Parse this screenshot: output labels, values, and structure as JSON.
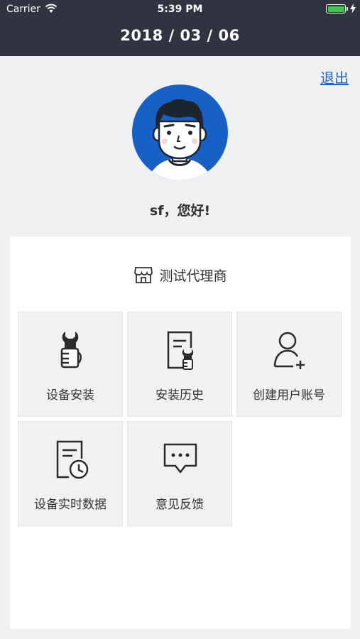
{
  "status_bar": {
    "carrier": "Carrier",
    "time": "5:39 PM"
  },
  "header": {
    "date": "2018 / 03 / 06"
  },
  "logout_label": "退出",
  "greeting": "sf，您好!",
  "company": {
    "name": "测试代理商",
    "icon": "storefront-icon"
  },
  "menu": [
    {
      "label": "设备安装",
      "icon": "install-wrench-icon"
    },
    {
      "label": "安装历史",
      "icon": "history-document-icon"
    },
    {
      "label": "创建用户账号",
      "icon": "add-user-icon"
    },
    {
      "label": "设备实时数据",
      "icon": "realtime-clock-document-icon"
    },
    {
      "label": "意见反馈",
      "icon": "feedback-chat-icon"
    }
  ],
  "colors": {
    "header_bg": "#303440",
    "accent": "#1f63c8",
    "avatar_bg": "#1960c4",
    "page_bg": "#eef0f2"
  }
}
